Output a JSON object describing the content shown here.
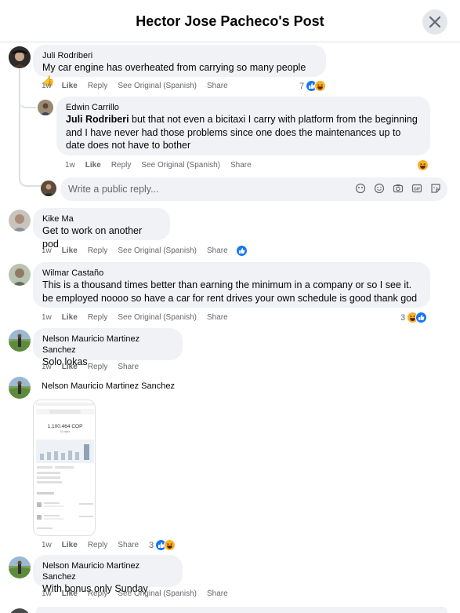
{
  "header": {
    "title": "Hector Jose Pacheco's Post"
  },
  "comments": [
    {
      "name": "Juli Rodriberi",
      "text": "My car engine has overheated from carrying so many people 👍",
      "time": "1w",
      "like": "Like",
      "reply": "Reply",
      "see_original": "See Original (Spanish)",
      "share": "Share",
      "reaction_count": "7"
    },
    {
      "name": "Edwin Carrillo",
      "mention": "Juli Rodriberi",
      "text": " but that not even a bicitaxi I carry with platform from the beginning and I have never had those problems since one does the maintenances up to date does not have to bother",
      "time": "1w",
      "like": "Like",
      "reply": "Reply",
      "see_original": "See Original (Spanish)",
      "share": "Share"
    },
    {
      "name": "Kike Ma",
      "text": "Get to work on another pod",
      "time": "1w",
      "like": "Like",
      "reply": "Reply",
      "see_original": "See Original (Spanish)",
      "share": "Share"
    },
    {
      "name": "Wilmar Castaño",
      "text": "This is a thousand times better than earning the minimum in a company or so I see it. be employed noooo so have a car for rent drives your own schedule is good thank god",
      "time": "1w",
      "like": "Like",
      "reply": "Reply",
      "see_original": "See Original (Spanish)",
      "share": "Share",
      "reaction_count": "3"
    },
    {
      "name": "Nelson Mauricio Martinez Sanchez",
      "text": "Solo lokas",
      "time": "1w",
      "like": "Like",
      "reply": "Reply",
      "share": "Share"
    },
    {
      "name": "Nelson Mauricio Martinez Sanchez",
      "time": "1w",
      "like": "Like",
      "reply": "Reply",
      "share": "Share",
      "reaction_count": "3",
      "screenshot": {
        "amount": "1.100.464 COP",
        "trips": "42 viajes"
      }
    },
    {
      "name": "Nelson Mauricio Martinez Sanchez",
      "text": "With bonus only Sunday",
      "time": "1w",
      "like": "Like",
      "reply": "Reply",
      "see_original": "See Original (Spanish)",
      "share": "Share"
    }
  ],
  "reply_box": {
    "placeholder": "Write a public reply..."
  },
  "colors": {
    "like_blue": "#1877f2",
    "haha_yellow": "#f7b125",
    "bubble_bg": "#f0f2f5",
    "meta_gray": "#65676b"
  }
}
